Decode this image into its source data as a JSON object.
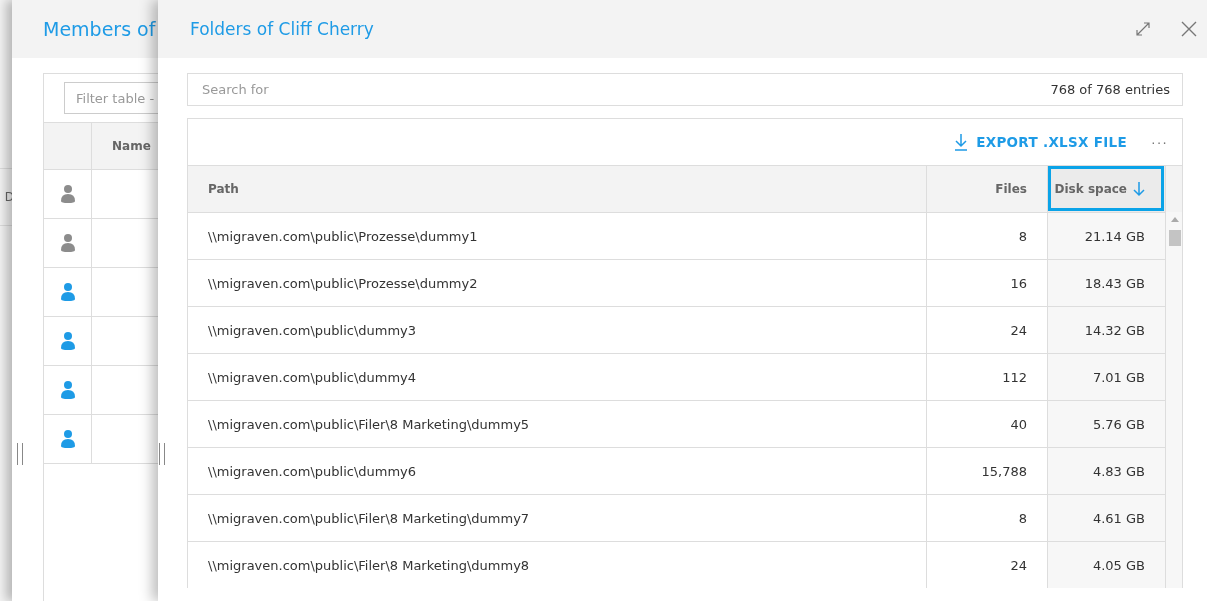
{
  "background_page": {
    "column_header": "D"
  },
  "members_panel": {
    "title": "Members of",
    "filter": {
      "placeholder": "Filter table -"
    },
    "columns": [
      "Name"
    ],
    "rows": [
      {
        "color": "#8c8c8c"
      },
      {
        "color": "#8c8c8c"
      },
      {
        "color": "#1e9be6"
      },
      {
        "color": "#1e9be6"
      },
      {
        "color": "#1e9be6"
      },
      {
        "color": "#1e9be6"
      }
    ]
  },
  "folders_panel": {
    "title": "Folders of Cliff Cherry",
    "search": {
      "placeholder": "Search for"
    },
    "entry_count": "768 of 768 entries",
    "export_button": "EXPORT .XLSX FILE",
    "more_button": "···",
    "columns": [
      {
        "label": "Path",
        "sorted": false,
        "focused": false
      },
      {
        "label": "Files",
        "sorted": false,
        "focused": false
      },
      {
        "label": "Disk space",
        "sorted": true,
        "focused": true
      }
    ],
    "rows": [
      {
        "path": "\\\\migraven.com\\public\\Prozesse\\dummy1",
        "files": "8",
        "disk_space": "21.14 GB"
      },
      {
        "path": "\\\\migraven.com\\public\\Prozesse\\dummy2",
        "files": "16",
        "disk_space": "18.43 GB"
      },
      {
        "path": "\\\\migraven.com\\public\\dummy3",
        "files": "24",
        "disk_space": "14.32 GB"
      },
      {
        "path": "\\\\migraven.com\\public\\dummy4",
        "files": "112",
        "disk_space": "7.01 GB"
      },
      {
        "path": "\\\\migraven.com\\public\\Filer\\8 Marketing\\dummy5",
        "files": "40",
        "disk_space": "5.76 GB"
      },
      {
        "path": "\\\\migraven.com\\public\\dummy6",
        "files": "15,788",
        "disk_space": "4.83 GB"
      },
      {
        "path": "\\\\migraven.com\\public\\Filer\\8 Marketing\\dummy7",
        "files": "8",
        "disk_space": "4.61 GB"
      },
      {
        "path": "\\\\migraven.com\\public\\Filer\\8 Marketing\\dummy8",
        "files": "24",
        "disk_space": "4.05 GB"
      }
    ]
  }
}
